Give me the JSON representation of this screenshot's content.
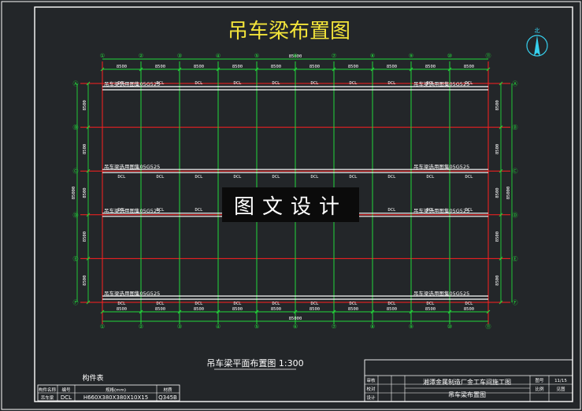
{
  "drawing": {
    "title": "吊车梁布置图",
    "north_label": "北",
    "plan_caption": "吊车梁平面布置图 1:300",
    "column_labels": [
      "①",
      "②",
      "③",
      "④",
      "⑤",
      "⑥",
      "⑦",
      "⑧",
      "⑨",
      "⑩",
      "⑪"
    ],
    "row_labels": [
      "Ⓐ",
      "Ⓑ",
      "Ⓒ",
      "Ⓓ",
      "Ⓔ",
      "Ⓕ"
    ],
    "bay_dim": "8500",
    "span_dim": "8500",
    "total_length": "85000",
    "total_width": "85000",
    "beam_tag": "DCL",
    "atlas_ref": "吊车梁选用图集05G525",
    "watermark": "图文设计"
  },
  "member_table": {
    "title": "构件表",
    "headers": [
      "构件名称",
      "编号",
      "规格(mm)",
      "材质"
    ],
    "row": [
      "吊车梁",
      "DCL",
      "H660X380X380X10X15",
      "Q345B"
    ]
  },
  "title_block": {
    "project": "湘潭金属制造厂金工车间施工图",
    "sheet_name": "吊车梁布置图",
    "left_labels": [
      "审核",
      "校对",
      "设计"
    ],
    "right_labels": [
      "图号",
      "比例"
    ],
    "sheet_no": "11/15",
    "scale_value": "见图"
  },
  "colors": {
    "background": "#232629",
    "frame": "#ffffff",
    "axis_red": "#ff2020",
    "axis_green": "#22d83a",
    "beam_white": "#ffffff",
    "title_yellow": "#f3e43a",
    "north_cyan": "#36d0ee"
  }
}
